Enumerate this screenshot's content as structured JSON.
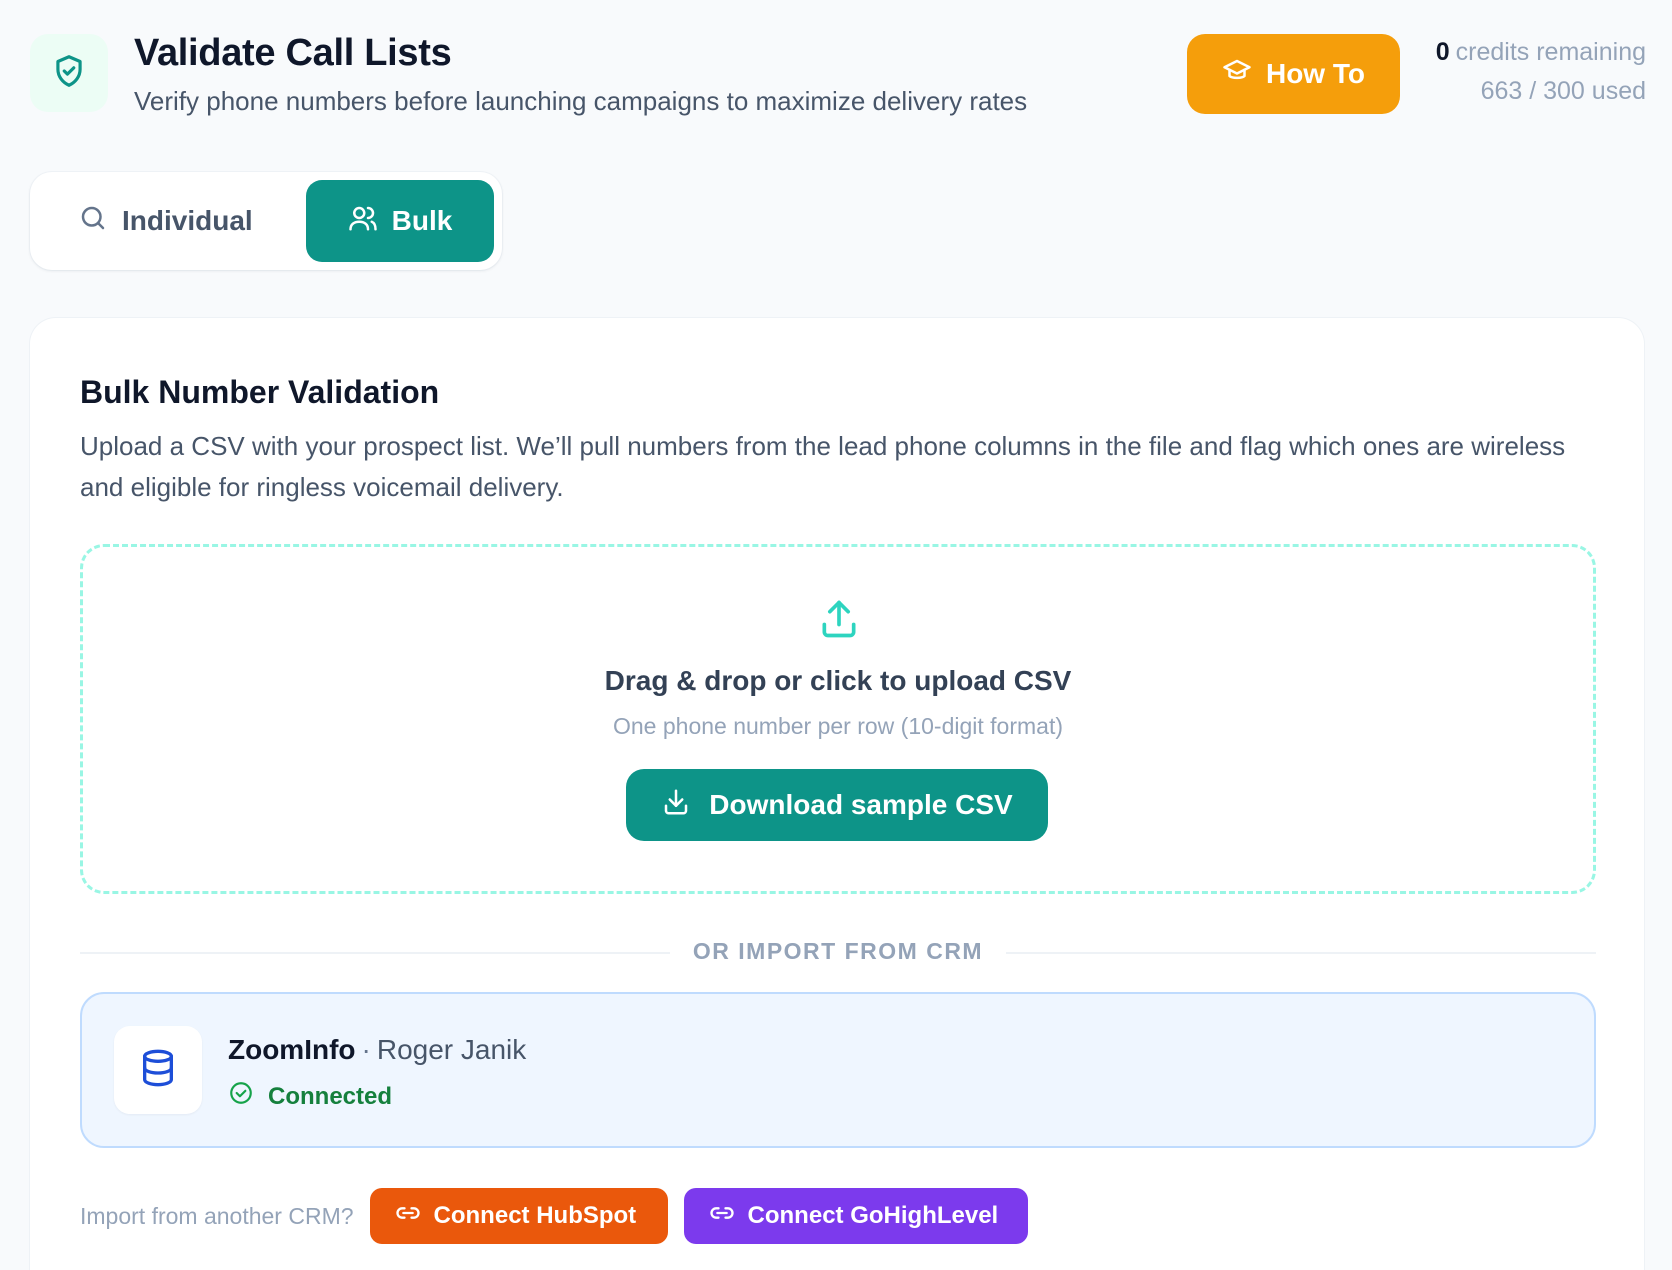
{
  "header": {
    "title": "Validate Call Lists",
    "subtitle": "Verify phone numbers before launching campaigns to maximize delivery rates",
    "icon": "shield-check-icon",
    "how_to_label": "How To",
    "credits_count": "0",
    "credits_label": "credits remaining",
    "credits_used": "663 / 300 used"
  },
  "tabs": [
    {
      "label": "Individual",
      "icon": "search-icon",
      "active": false
    },
    {
      "label": "Bulk",
      "icon": "users-icon",
      "active": true
    }
  ],
  "card": {
    "title": "Bulk Number Validation",
    "description": "Upload a CSV with your prospect list. We’ll pull numbers from the lead phone columns in the file and flag which ones are wireless and eligible for ringless voicemail delivery.",
    "dropzone": {
      "title": "Drag & drop or click to upload CSV",
      "subtitle": "One phone number per row (10-digit format)",
      "button_label": "Download sample CSV"
    },
    "divider_label": "OR IMPORT FROM CRM",
    "crm": {
      "name": "ZoomInfo",
      "separator": "·",
      "user": "Roger Janik",
      "status": "Connected"
    },
    "other_crm": {
      "label": "Import from another CRM?",
      "hubspot_label": "Connect HubSpot",
      "ghl_label": "Connect GoHighLevel"
    }
  },
  "colors": {
    "accent": "#0d9488",
    "how_to": "#f59e0b",
    "hubspot": "#ea580c",
    "gohighlevel": "#7c3aed",
    "connected": "#15803d"
  }
}
